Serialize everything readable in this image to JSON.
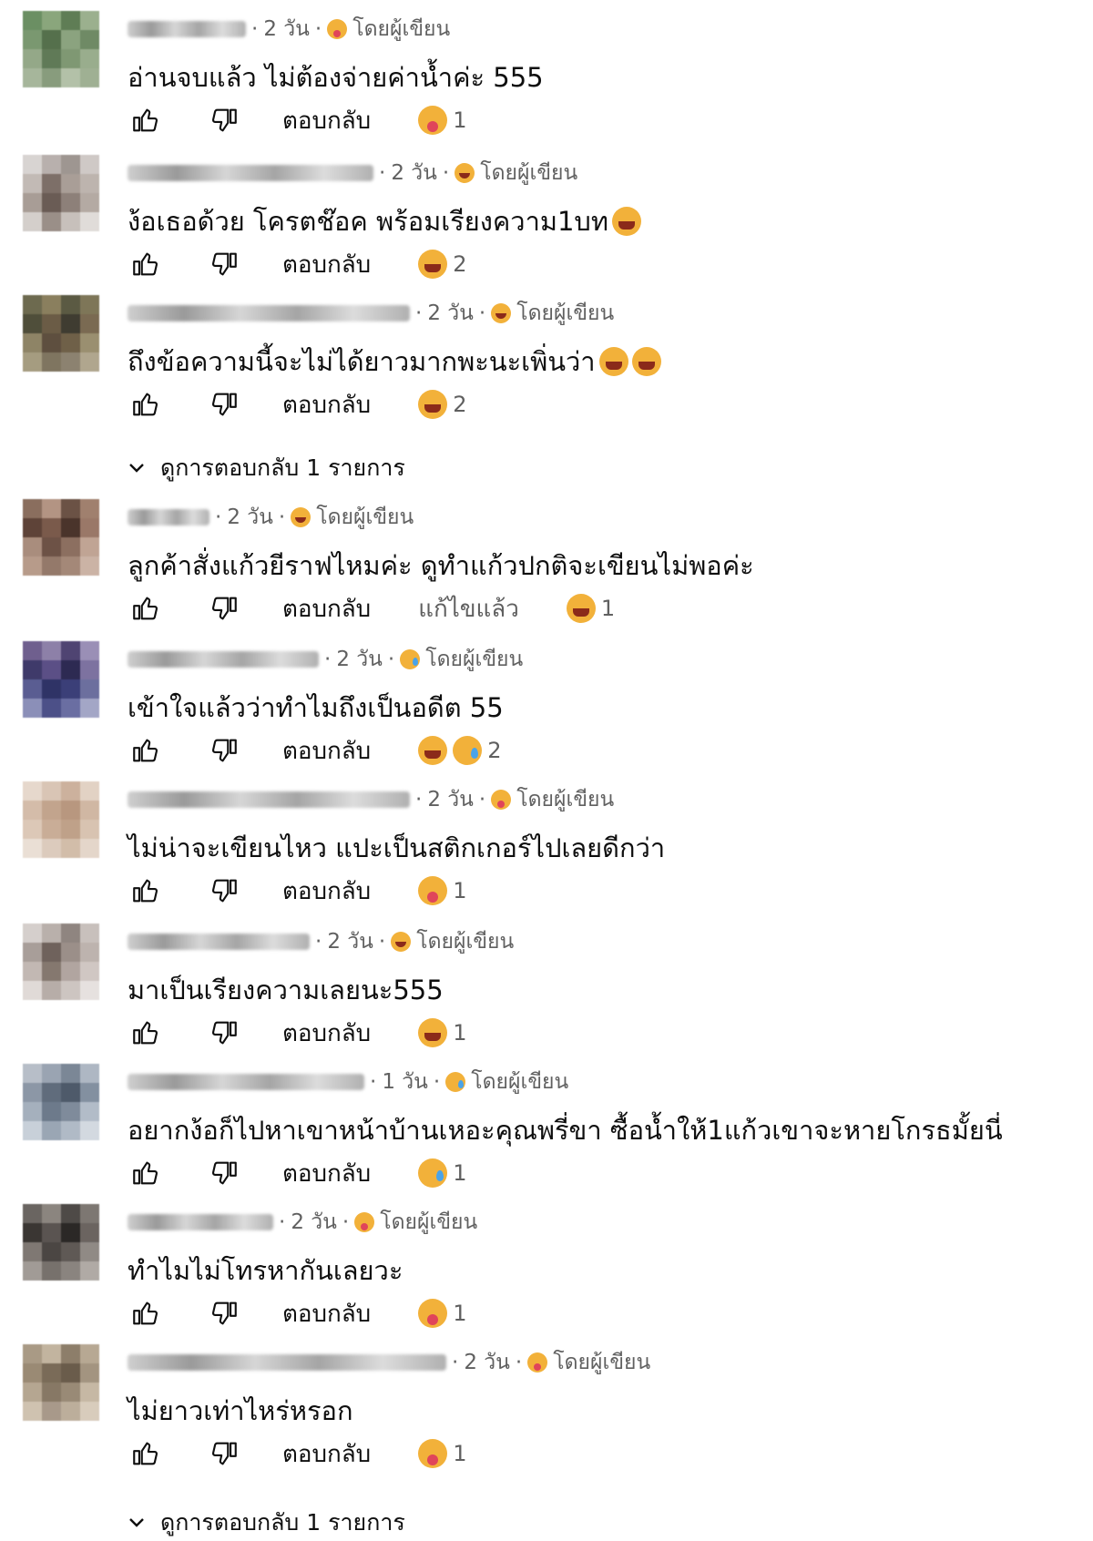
{
  "labels": {
    "reply": "ตอบกลับ",
    "by_author": "โดยผู้เขียน",
    "edited": "แก้ไขแล้ว"
  },
  "comments": [
    {
      "time": "2 วัน",
      "text": "อ่านจบแล้ว ไม่ต้องจ่ายค่าน้ำค่ะ 555",
      "author_emoji": "tongue",
      "reactions": [
        "tongue"
      ],
      "count": "1",
      "edited": false,
      "avatar_colors": [
        "#6b8f63",
        "#8aa67c",
        "#5f7d55",
        "#9bb08e",
        "#7a9870",
        "#55704c",
        "#8ba37f",
        "#6f8a65",
        "#94a888",
        "#607a57",
        "#7f9873",
        "#99ad8d",
        "#a6b69b",
        "#889c7d",
        "#b3c1a8",
        "#9fb093"
      ]
    },
    {
      "time": "2 วัน",
      "text": "ง้อเธอด้วย โครตช๊อค พร้อมเรียงความ1บท",
      "text_emojis": [
        "laugh"
      ],
      "author_emoji": "laugh",
      "reactions": [
        "laugh"
      ],
      "count": "2",
      "edited": false,
      "avatar_colors": [
        "#d8d4d2",
        "#b8b0ad",
        "#9e9691",
        "#cfc9c6",
        "#c2bab5",
        "#7d6f68",
        "#a99e97",
        "#bdb4ae",
        "#a89d96",
        "#6a5c55",
        "#8d8079",
        "#b4aaa3",
        "#d4cfcb",
        "#9a8f88",
        "#c7c0bb",
        "#e0dcd9"
      ]
    },
    {
      "time": "2 วัน",
      "text": "ถึงข้อความนี้จะไม่ได้ยาวมากพะนะเพิ่นว่า",
      "text_emojis": [
        "laugh",
        "laugh"
      ],
      "author_emoji": "laugh",
      "reactions": [
        "laugh"
      ],
      "count": "2",
      "edited": false,
      "avatar_colors": [
        "#6d6a4f",
        "#8a7f5e",
        "#5b5a43",
        "#7e7658",
        "#4f4e3a",
        "#6b5c46",
        "#3f3c31",
        "#7a6a52",
        "#8e8466",
        "#5e4f3f",
        "#6f6048",
        "#9a8f70",
        "#a59c80",
        "#7f7560",
        "#8c8270",
        "#b0a68e"
      ]
    },
    {
      "time": "2 วัน",
      "text": "ลูกค้าสั่งแก้วยีราฟไหมค่ะ ดูทำแก้วปกติจะเขียนไม่พอค่ะ",
      "author_emoji": "laugh",
      "reactions": [
        "laugh"
      ],
      "count": "1",
      "edited": true,
      "avatar_colors": [
        "#8a6e5e",
        "#b39483",
        "#6b5245",
        "#a0806e",
        "#5e4338",
        "#7a5a4b",
        "#4a342b",
        "#9a7868",
        "#a98d7d",
        "#6d5246",
        "#8c6f60",
        "#c0a494",
        "#b79b8a",
        "#94796a",
        "#a48878",
        "#cbb3a5"
      ]
    },
    {
      "time": "2 วัน",
      "text": "เข้าใจแล้วว่าทำไมถึงเป็นอดีต 55",
      "author_emoji": "tear",
      "reactions": [
        "laugh",
        "tear"
      ],
      "count": "2",
      "edited": false,
      "avatar_colors": [
        "#6f5f8e",
        "#8d80a8",
        "#4f4472",
        "#9a8fb6",
        "#3f3a6a",
        "#5b4f86",
        "#2d2a52",
        "#7d72a0",
        "#5a5d92",
        "#2f3366",
        "#3b3f78",
        "#6c6f9e",
        "#8b8fb8",
        "#4c5088",
        "#6a6ea2",
        "#a3a6c6"
      ]
    },
    {
      "time": "2 วัน",
      "text": "ไม่น่าจะเขียนไหว แปะเป็นสติกเกอร์ไปเลยดีกว่า",
      "author_emoji": "tongue",
      "reactions": [
        "tongue"
      ],
      "count": "1",
      "edited": false,
      "avatar_colors": [
        "#e6d8cc",
        "#d9c5b5",
        "#ccb19d",
        "#e2d2c4",
        "#d4bca9",
        "#c2a48d",
        "#b8977f",
        "#d0b7a3",
        "#dcc8b7",
        "#c9ad97",
        "#bfa189",
        "#d8c3b1",
        "#eadfd5",
        "#dccbbd",
        "#d2bda9",
        "#e4d6ca"
      ]
    },
    {
      "time": "2 วัน",
      "text": "มาเป็นเรียงความเลยนะ555",
      "author_emoji": "laugh",
      "reactions": [
        "laugh"
      ],
      "count": "1",
      "edited": false,
      "avatar_colors": [
        "#d5cfcc",
        "#b9b0ab",
        "#8f8580",
        "#c8c0bc",
        "#a89e99",
        "#6f625c",
        "#9b8f89",
        "#bdb3ae",
        "#c2b8b3",
        "#85786f",
        "#b1a5a0",
        "#d0c7c3",
        "#e0dad7",
        "#b7ada8",
        "#cdc5c1",
        "#e6e1df"
      ]
    },
    {
      "time": "1 วัน",
      "text": "อยากง้อก็ไปหาเขาหน้าบ้านเหอะคุณพรี่ขา ซื้อน้ำให้1แก้วเขาจะหายโกรธมั้ยนี่",
      "author_emoji": "tear",
      "reactions": [
        "tear"
      ],
      "count": "1",
      "edited": false,
      "avatar_colors": [
        "#b7bec8",
        "#9aa4b2",
        "#7b8796",
        "#aeb7c3",
        "#8c97a6",
        "#606c7c",
        "#4e5a6a",
        "#8390a0",
        "#a5b0bd",
        "#6d7a8b",
        "#7f8b9b",
        "#b2bcc8",
        "#c8d0d9",
        "#9aa6b4",
        "#b0bac6",
        "#d3d9e0"
      ]
    },
    {
      "time": "2 วัน",
      "text": "ทำไมไม่โทรหากันเลยวะ",
      "author_emoji": "tongue",
      "reactions": [
        "tongue"
      ],
      "count": "1",
      "edited": false,
      "avatar_colors": [
        "#6a6561",
        "#8b857f",
        "#4e4a47",
        "#7d7772",
        "#3a3633",
        "#5a5451",
        "#2b2826",
        "#6b6460",
        "#7f7873",
        "#4b4643",
        "#5f5955",
        "#908a85",
        "#a19b96",
        "#77716c",
        "#8a847f",
        "#b0aaa5"
      ]
    },
    {
      "time": "2 วัน",
      "text": "ไม่ยาวเท่าไหร่หรอก",
      "author_emoji": "tongue",
      "reactions": [
        "tongue"
      ],
      "count": "1",
      "edited": false,
      "avatar_colors": [
        "#a99a85",
        "#c2b49f",
        "#8d7e6a",
        "#b7a893",
        "#9a8a74",
        "#7a6b58",
        "#6a5c4b",
        "#a39480",
        "#b5a691",
        "#877865",
        "#998a76",
        "#c6b8a4",
        "#cfc2b0",
        "#a8998a",
        "#bcae9b",
        "#d8ccbc"
      ]
    }
  ],
  "view_replies": [
    {
      "label": "ดูการตอบกลับ 1 รายการ"
    },
    {
      "label": "ดูการตอบกลับ 1 รายการ"
    }
  ]
}
